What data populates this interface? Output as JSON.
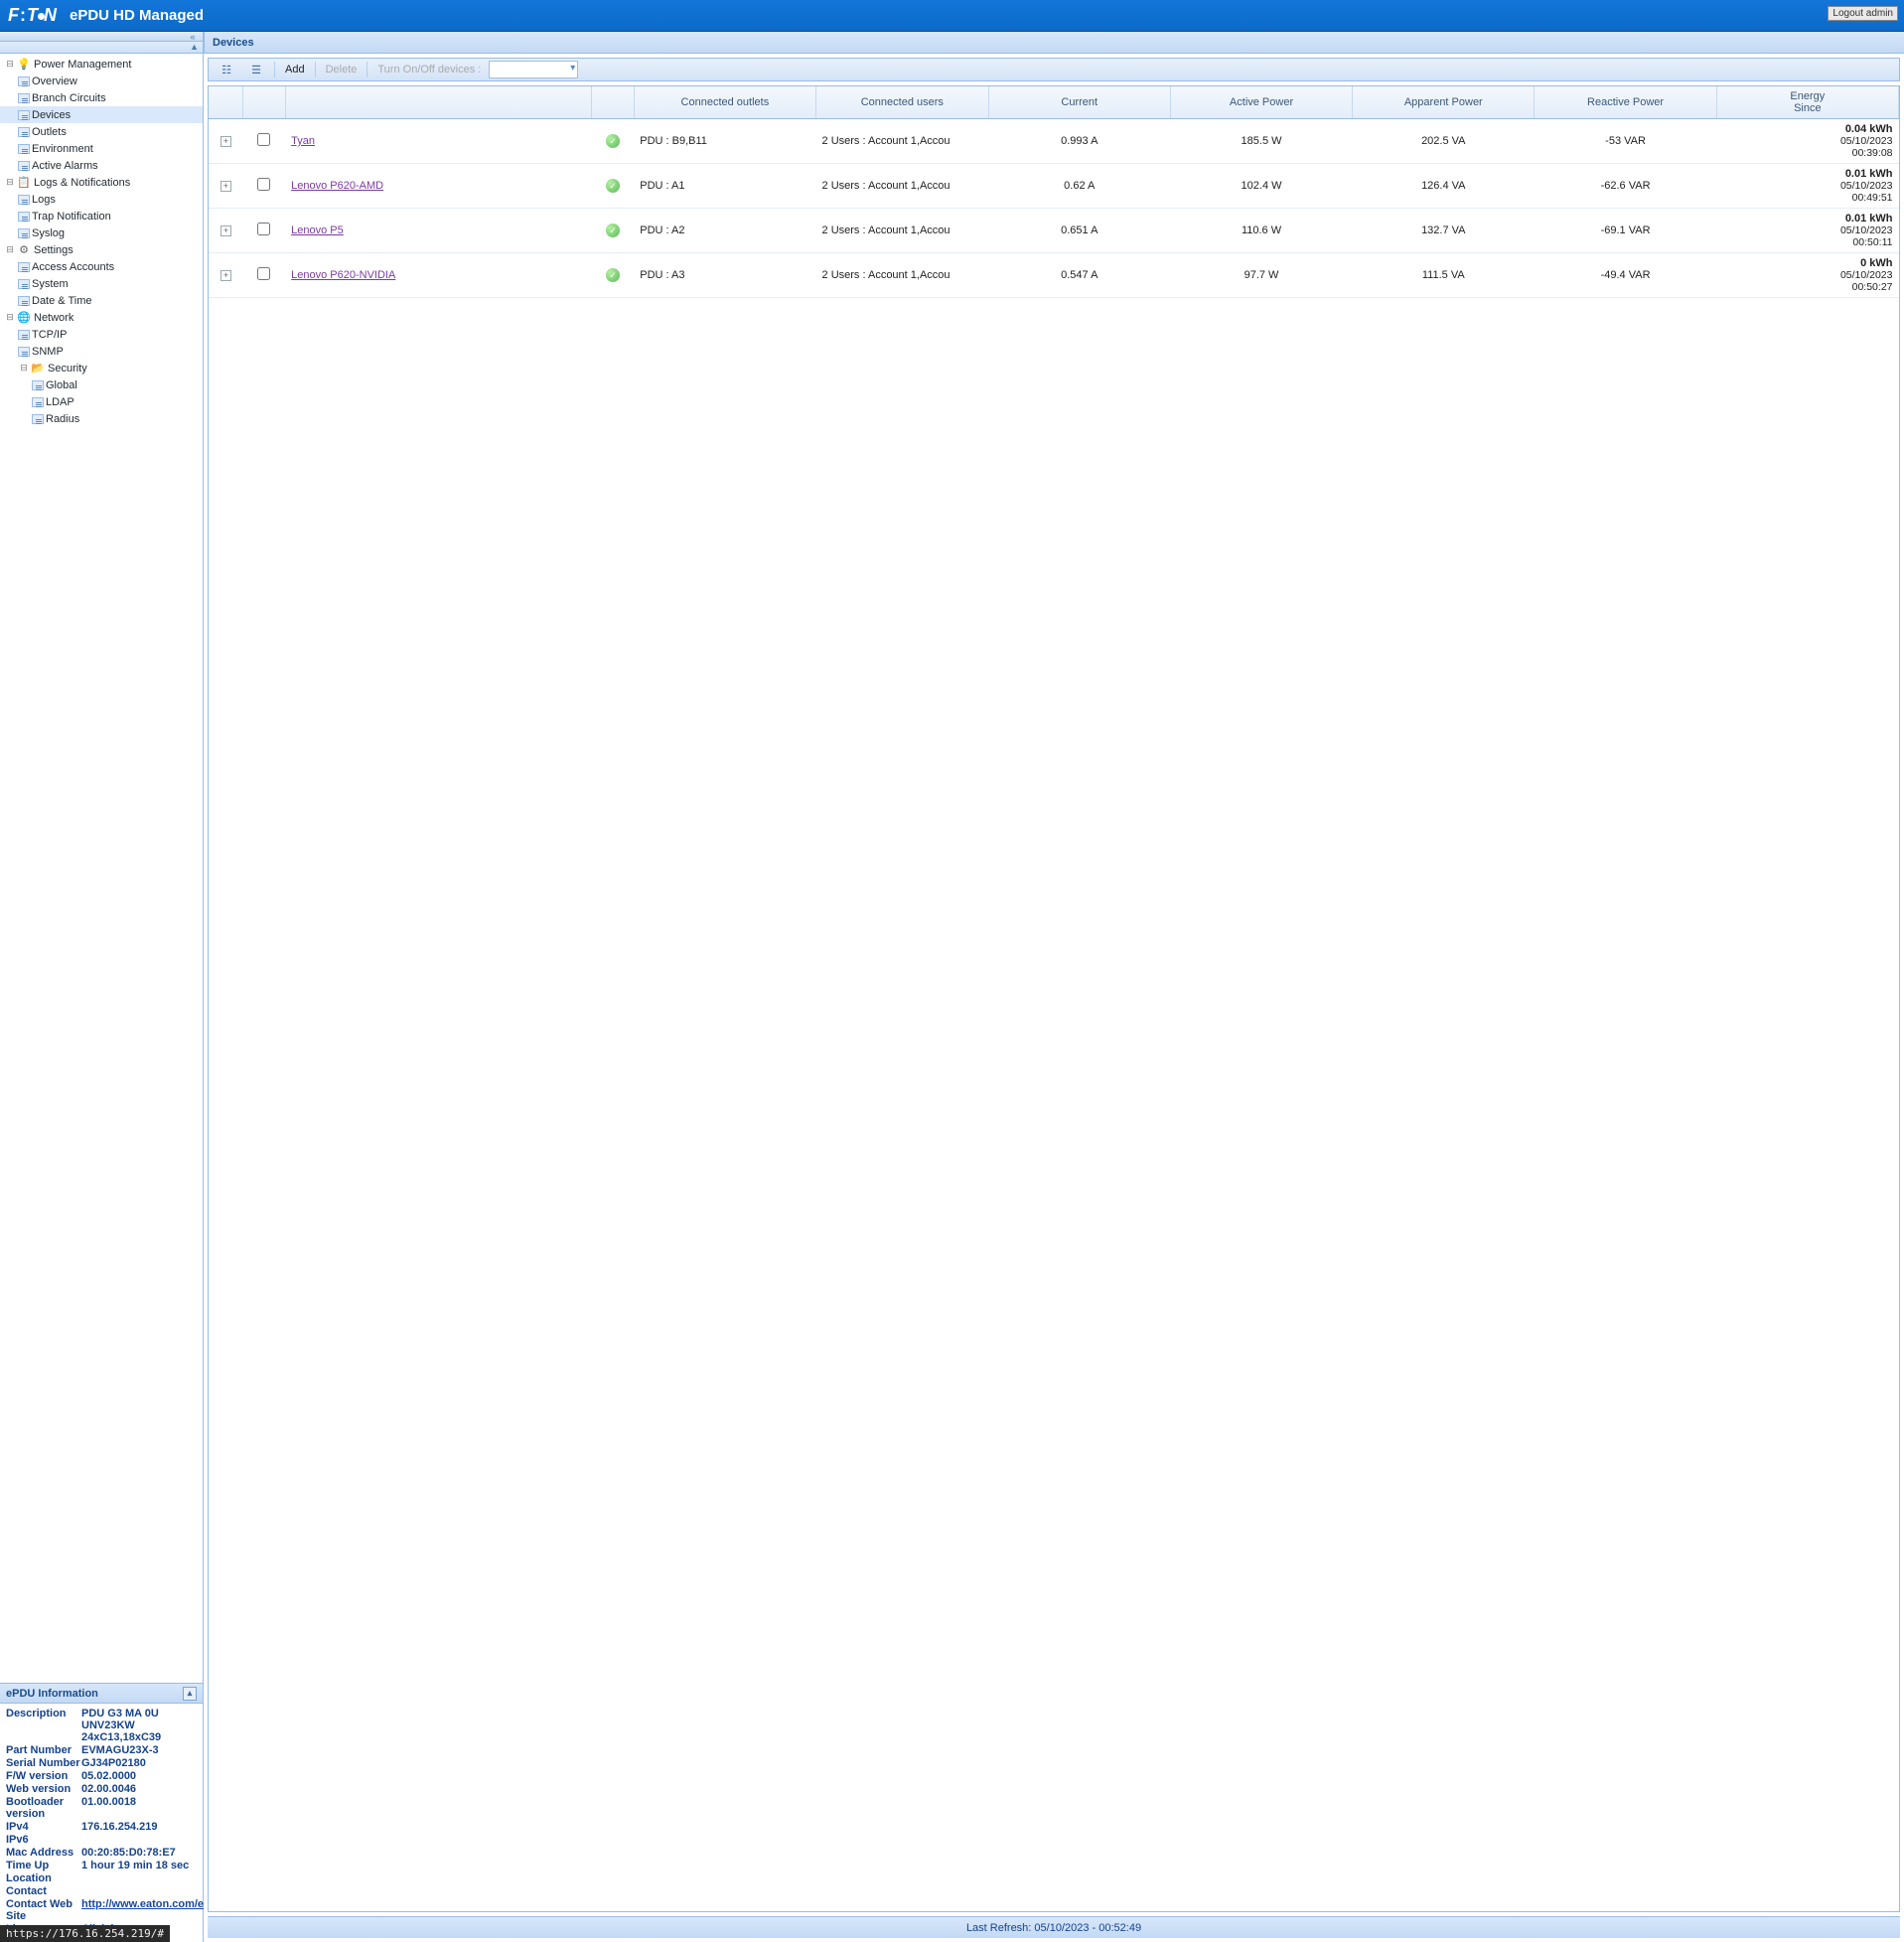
{
  "header": {
    "brand": "E·T·N",
    "title": "ePDU HD Managed",
    "logout": "Logout admin"
  },
  "nav": {
    "power_mgmt": "Power Management",
    "overview": "Overview",
    "branch": "Branch Circuits",
    "devices": "Devices",
    "outlets": "Outlets",
    "environment": "Environment",
    "alarms": "Active Alarms",
    "logs": "Logs & Notifications",
    "logs_sub": "Logs",
    "trap": "Trap Notification",
    "syslog": "Syslog",
    "settings": "Settings",
    "access": "Access Accounts",
    "system": "System",
    "datetime": "Date & Time",
    "network": "Network",
    "tcpip": "TCP/IP",
    "snmp": "SNMP",
    "security": "Security",
    "global": "Global",
    "ldap": "LDAP",
    "radius": "Radius"
  },
  "info": {
    "title": "ePDU Information",
    "rows": [
      {
        "label": "Description",
        "value": "PDU G3 MA 0U UNV23KW 24xC13,18xC39"
      },
      {
        "label": "Part Number",
        "value": "EVMAGU23X-3"
      },
      {
        "label": "Serial Number",
        "value": "GJ34P02180"
      },
      {
        "label": "F/W version",
        "value": "05.02.0000"
      },
      {
        "label": "Web version",
        "value": "02.00.0046"
      },
      {
        "label": "Bootloader version",
        "value": "01.00.0018"
      },
      {
        "label": "IPv4",
        "value": "176.16.254.219"
      },
      {
        "label": "IPv6",
        "value": ""
      },
      {
        "label": "Mac Address",
        "value": "00:20:85:D0:78:E7"
      },
      {
        "label": "Time Up",
        "value": "1 hour 19 min 18 sec"
      },
      {
        "label": "Location",
        "value": ""
      },
      {
        "label": "Contact",
        "value": ""
      }
    ],
    "website_label": "Contact Web Site",
    "website_url": "http://www.eaton.com/ePDU",
    "licenses_label": "Licenses",
    "licenses_link": "Click here"
  },
  "main": {
    "title": "Devices",
    "toolbar": {
      "add": "Add",
      "delete": "Delete",
      "turn": "Turn On/Off devices :"
    },
    "columns": {
      "outlets": "Connected outlets",
      "users": "Connected users",
      "current": "Current",
      "active": "Active Power",
      "apparent": "Apparent Power",
      "reactive": "Reactive Power",
      "energy": "Energy",
      "since": "Since"
    },
    "rows": [
      {
        "name": "Tyan",
        "outlets": "PDU : B9,B11",
        "users": "2 Users : Account 1,Accou",
        "current": "0.993 A",
        "active": "185.5 W",
        "apparent": "202.5 VA",
        "reactive": "-53 VAR",
        "energy": "0.04 kWh",
        "date": "05/10/2023",
        "time": "00:39:08"
      },
      {
        "name": "Lenovo P620-AMD",
        "outlets": "PDU : A1",
        "users": "2 Users : Account 1,Accou",
        "current": "0.62 A",
        "active": "102.4 W",
        "apparent": "126.4 VA",
        "reactive": "-62.6 VAR",
        "energy": "0.01 kWh",
        "date": "05/10/2023",
        "time": "00:49:51"
      },
      {
        "name": "Lenovo P5",
        "outlets": "PDU : A2",
        "users": "2 Users : Account 1,Accou",
        "current": "0.651 A",
        "active": "110.6 W",
        "apparent": "132.7 VA",
        "reactive": "-69.1 VAR",
        "energy": "0.01 kWh",
        "date": "05/10/2023",
        "time": "00:50:11"
      },
      {
        "name": "Lenovo P620-NVIDIA",
        "outlets": "PDU : A3",
        "users": "2 Users : Account 1,Accou",
        "current": "0.547 A",
        "active": "97.7 W",
        "apparent": "111.5 VA",
        "reactive": "-49.4 VAR",
        "energy": "0 kWh",
        "date": "05/10/2023",
        "time": "00:50:27"
      }
    ],
    "footer": "Last Refresh: 05/10/2023 - 00:52:49"
  },
  "status_url": "https://176.16.254.219/#"
}
